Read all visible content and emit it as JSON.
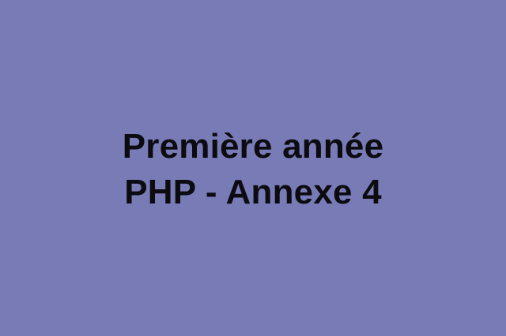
{
  "background_color": "#787bb6",
  "text_color": "#0b0b10",
  "title": {
    "line1": "Première année",
    "line2": "PHP - Annexe 4"
  }
}
